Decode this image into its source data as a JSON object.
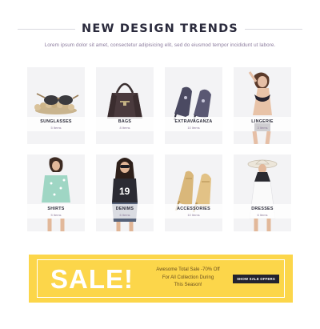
{
  "header": {
    "title": "NEW DESIGN TRENDS",
    "subtitle": "Lorem ipsum dolor sit amet, consectetur adipisicing elit, sed do eiusmod tempor incididunt ut labore."
  },
  "categories": [
    {
      "label": "SUNGLASSES",
      "count": "5 Items",
      "icon": "sunglasses"
    },
    {
      "label": "BAGS",
      "count": "8 Items",
      "icon": "handbag"
    },
    {
      "label": "EXTRAVAGANZA",
      "count": "10 Items",
      "icon": "high-heels"
    },
    {
      "label": "LINGERIE",
      "count": "3 Items",
      "icon": "lingerie-model"
    },
    {
      "label": "SHIRTS",
      "count": "5 Items",
      "icon": "shirt-model"
    },
    {
      "label": "DENIMS",
      "count": "6 Items",
      "icon": "denim-model"
    },
    {
      "label": "ACCESSORIES",
      "count": "10 Items",
      "icon": "sandal-heels"
    },
    {
      "label": "DRESSES",
      "count": "6 Items",
      "icon": "dress-model"
    }
  ],
  "sale": {
    "headline": "SALE!",
    "line1": "Awesome Total Sale -70% Off",
    "line2": "For All Collection During",
    "line3": "This Season!",
    "button_label": "SHOW SALE OFFERS"
  },
  "colors": {
    "accent_yellow": "#fcd64a",
    "title": "#2a2a3c",
    "button": "#23232f"
  }
}
